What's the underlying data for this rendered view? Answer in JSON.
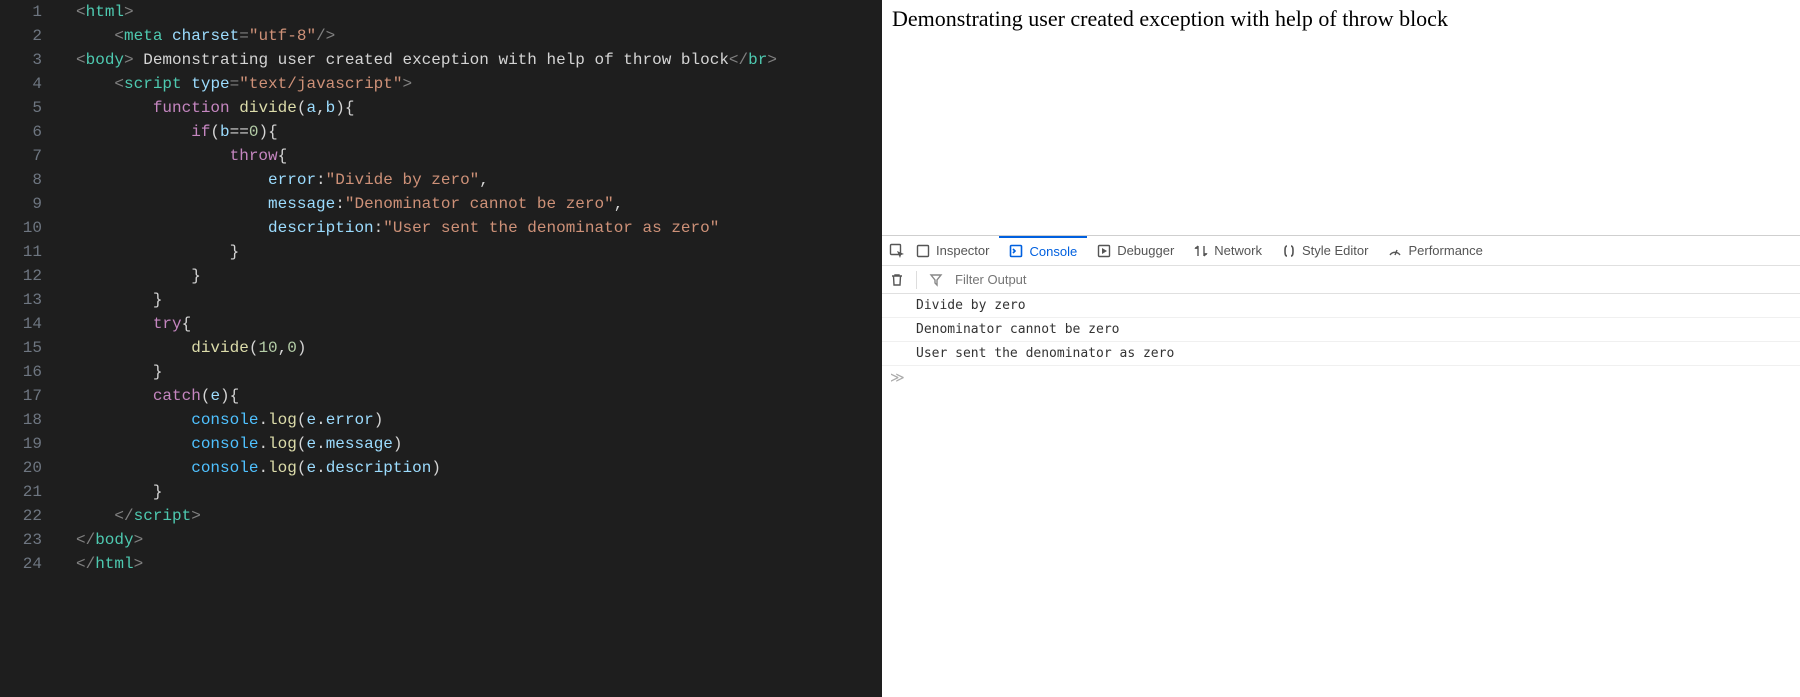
{
  "editor": {
    "line_count": 24,
    "highlighted_line": 15,
    "lines": [
      [
        [
          "punct",
          "<"
        ],
        [
          "tag",
          "html"
        ],
        [
          "punct",
          ">"
        ]
      ],
      [
        [
          "plain",
          "    "
        ],
        [
          "punct",
          "<"
        ],
        [
          "tag",
          "meta"
        ],
        [
          "plain",
          " "
        ],
        [
          "attr",
          "charset"
        ],
        [
          "punct",
          "="
        ],
        [
          "str",
          "\"utf-8\""
        ],
        [
          "punct",
          "/>"
        ]
      ],
      [
        [
          "punct",
          "<"
        ],
        [
          "tag",
          "body"
        ],
        [
          "punct",
          "> "
        ],
        [
          "plain",
          "Demonstrating user created exception with help of throw block"
        ],
        [
          "punct",
          "</"
        ],
        [
          "tag",
          "br"
        ],
        [
          "punct",
          ">"
        ]
      ],
      [
        [
          "plain",
          "    "
        ],
        [
          "punct",
          "<"
        ],
        [
          "tag",
          "script"
        ],
        [
          "plain",
          " "
        ],
        [
          "attr",
          "type"
        ],
        [
          "punct",
          "="
        ],
        [
          "str",
          "\"text/javascript\""
        ],
        [
          "punct",
          ">"
        ]
      ],
      [
        [
          "plain",
          "        "
        ],
        [
          "kw",
          "function"
        ],
        [
          "plain",
          " "
        ],
        [
          "fn",
          "divide"
        ],
        [
          "brace",
          "("
        ],
        [
          "var",
          "a"
        ],
        [
          "plain",
          ","
        ],
        [
          "var",
          "b"
        ],
        [
          "brace",
          ")"
        ],
        [
          "brace",
          "{"
        ]
      ],
      [
        [
          "plain",
          "            "
        ],
        [
          "kw",
          "if"
        ],
        [
          "brace",
          "("
        ],
        [
          "var",
          "b"
        ],
        [
          "plain",
          "=="
        ],
        [
          "num",
          "0"
        ],
        [
          "brace",
          ")"
        ],
        [
          "brace",
          "{"
        ]
      ],
      [
        [
          "plain",
          "                "
        ],
        [
          "kw",
          "throw"
        ],
        [
          "brace",
          "{"
        ]
      ],
      [
        [
          "plain",
          "                    "
        ],
        [
          "var",
          "error"
        ],
        [
          "plain",
          ":"
        ],
        [
          "str",
          "\"Divide by zero\""
        ],
        [
          "plain",
          ","
        ]
      ],
      [
        [
          "plain",
          "                    "
        ],
        [
          "var",
          "message"
        ],
        [
          "plain",
          ":"
        ],
        [
          "str",
          "\"Denominator cannot be zero\""
        ],
        [
          "plain",
          ","
        ]
      ],
      [
        [
          "plain",
          "                    "
        ],
        [
          "var",
          "description"
        ],
        [
          "plain",
          ":"
        ],
        [
          "str",
          "\"User sent the denominator as zero\""
        ]
      ],
      [
        [
          "plain",
          "                "
        ],
        [
          "brace",
          "}"
        ]
      ],
      [
        [
          "plain",
          "            "
        ],
        [
          "brace",
          "}"
        ]
      ],
      [
        [
          "plain",
          "        "
        ],
        [
          "brace",
          "}"
        ]
      ],
      [
        [
          "plain",
          "        "
        ],
        [
          "kw",
          "try"
        ],
        [
          "brace",
          "{"
        ]
      ],
      [
        [
          "plain",
          "            "
        ],
        [
          "fn",
          "divide"
        ],
        [
          "brace",
          "("
        ],
        [
          "num",
          "10"
        ],
        [
          "plain",
          ","
        ],
        [
          "num",
          "0"
        ],
        [
          "brace",
          ")"
        ]
      ],
      [
        [
          "plain",
          "        "
        ],
        [
          "brace",
          "}"
        ]
      ],
      [
        [
          "plain",
          "        "
        ],
        [
          "kw",
          "catch"
        ],
        [
          "brace",
          "("
        ],
        [
          "var",
          "e"
        ],
        [
          "brace",
          ")"
        ],
        [
          "brace",
          "{"
        ]
      ],
      [
        [
          "plain",
          "            "
        ],
        [
          "obj",
          "console"
        ],
        [
          "plain",
          "."
        ],
        [
          "fn",
          "log"
        ],
        [
          "brace",
          "("
        ],
        [
          "var",
          "e"
        ],
        [
          "plain",
          "."
        ],
        [
          "var",
          "error"
        ],
        [
          "brace",
          ")"
        ]
      ],
      [
        [
          "plain",
          "            "
        ],
        [
          "obj",
          "console"
        ],
        [
          "plain",
          "."
        ],
        [
          "fn",
          "log"
        ],
        [
          "brace",
          "("
        ],
        [
          "var",
          "e"
        ],
        [
          "plain",
          "."
        ],
        [
          "var",
          "message"
        ],
        [
          "brace",
          ")"
        ]
      ],
      [
        [
          "plain",
          "            "
        ],
        [
          "obj",
          "console"
        ],
        [
          "plain",
          "."
        ],
        [
          "fn",
          "log"
        ],
        [
          "brace",
          "("
        ],
        [
          "var",
          "e"
        ],
        [
          "plain",
          "."
        ],
        [
          "var",
          "description"
        ],
        [
          "brace",
          ")"
        ]
      ],
      [
        [
          "plain",
          "        "
        ],
        [
          "brace",
          "}"
        ]
      ],
      [
        [
          "plain",
          "    "
        ],
        [
          "punct",
          "</"
        ],
        [
          "tag",
          "script"
        ],
        [
          "punct",
          ">"
        ]
      ],
      [
        [
          "punct",
          "</"
        ],
        [
          "tag",
          "body"
        ],
        [
          "punct",
          ">"
        ]
      ],
      [
        [
          "punct",
          "</"
        ],
        [
          "tag",
          "html"
        ],
        [
          "punct",
          ">"
        ]
      ]
    ]
  },
  "page": {
    "body_text": "Demonstrating user created exception with help of throw block"
  },
  "devtools": {
    "tabs": [
      {
        "id": "inspector",
        "label": "Inspector"
      },
      {
        "id": "console",
        "label": "Console"
      },
      {
        "id": "debugger",
        "label": "Debugger"
      },
      {
        "id": "network",
        "label": "Network"
      },
      {
        "id": "styleeditor",
        "label": "Style Editor"
      },
      {
        "id": "performance",
        "label": "Performance"
      }
    ],
    "active_tab": "console",
    "filter_placeholder": "Filter Output",
    "console_rows": [
      "Divide by zero",
      "Denominator cannot be zero",
      "User sent the denominator as zero"
    ],
    "prompt": "≫"
  }
}
